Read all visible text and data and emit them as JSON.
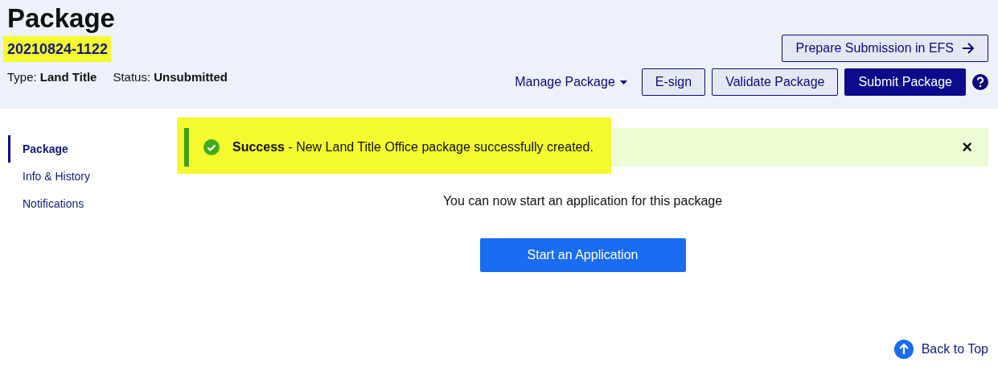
{
  "header": {
    "title": "Package",
    "package_number": {
      "text": "20210824-1122",
      "highlighted": true
    },
    "meta": [
      {
        "label": "Type:",
        "value": "Land Title"
      },
      {
        "label": "Status:",
        "value": "Unsubmitted"
      }
    ],
    "efs_button": "Prepare Submission in EFS",
    "manage_menu": "Manage Package",
    "actions": [
      {
        "label": "E-sign",
        "kind": "outline"
      },
      {
        "label": "Validate Package",
        "kind": "outline"
      },
      {
        "label": "Submit Package",
        "kind": "primary"
      }
    ]
  },
  "sidebar": {
    "items": [
      {
        "label": "Package",
        "selected": true
      },
      {
        "label": "Info & History",
        "selected": false
      },
      {
        "label": "Notifications",
        "selected": false
      }
    ]
  },
  "alert": {
    "title": "Success",
    "message": " - New Land Title Office package successfully created.",
    "highlighted": true,
    "close": "×"
  },
  "body": {
    "message": "You can now start an application for this package",
    "button": "Start an Application"
  },
  "back_to_top": "Back to Top"
}
